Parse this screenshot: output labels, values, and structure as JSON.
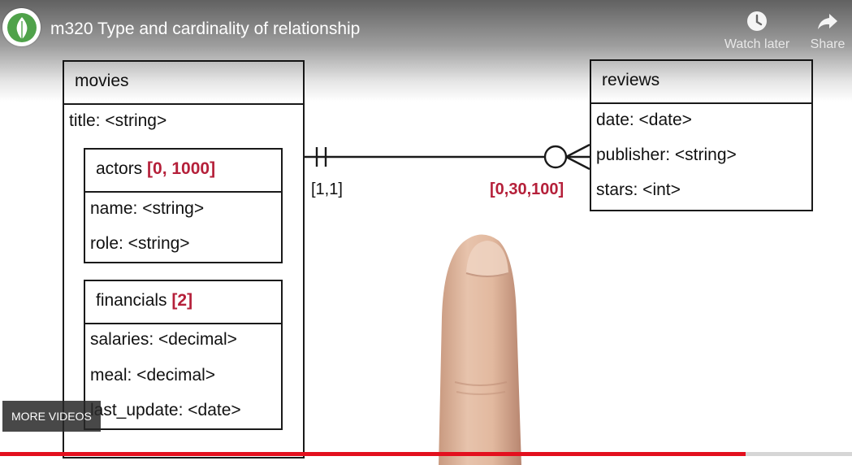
{
  "player": {
    "title": "m320 Type and cardinality of relationship",
    "watch_later_label": "Watch later",
    "share_label": "Share",
    "more_videos_label": "MORE VIDEOS",
    "progress_fraction": 0.875,
    "progress_color": "#e3101e",
    "logo_icon": "mongodb-leaf-icon"
  },
  "diagram": {
    "movies": {
      "title": "movies",
      "field_title": "title: <string>",
      "actors": {
        "name": "actors",
        "cardinality": "[0, 1000]",
        "fields": [
          "name: <string>",
          "role: <string>"
        ]
      },
      "financials": {
        "name": "financials",
        "cardinality": "[2]",
        "fields": [
          "salaries: <decimal>",
          "meal: <decimal>",
          "last_update: <date>"
        ]
      }
    },
    "reviews": {
      "title": "reviews",
      "fields": [
        "date: <date>",
        "publisher: <string>",
        "stars: <int>"
      ]
    },
    "relationship": {
      "left_cardinality": "[1,1]",
      "right_cardinality": "[0,30,100]"
    },
    "accent_color": "#b5203a"
  }
}
